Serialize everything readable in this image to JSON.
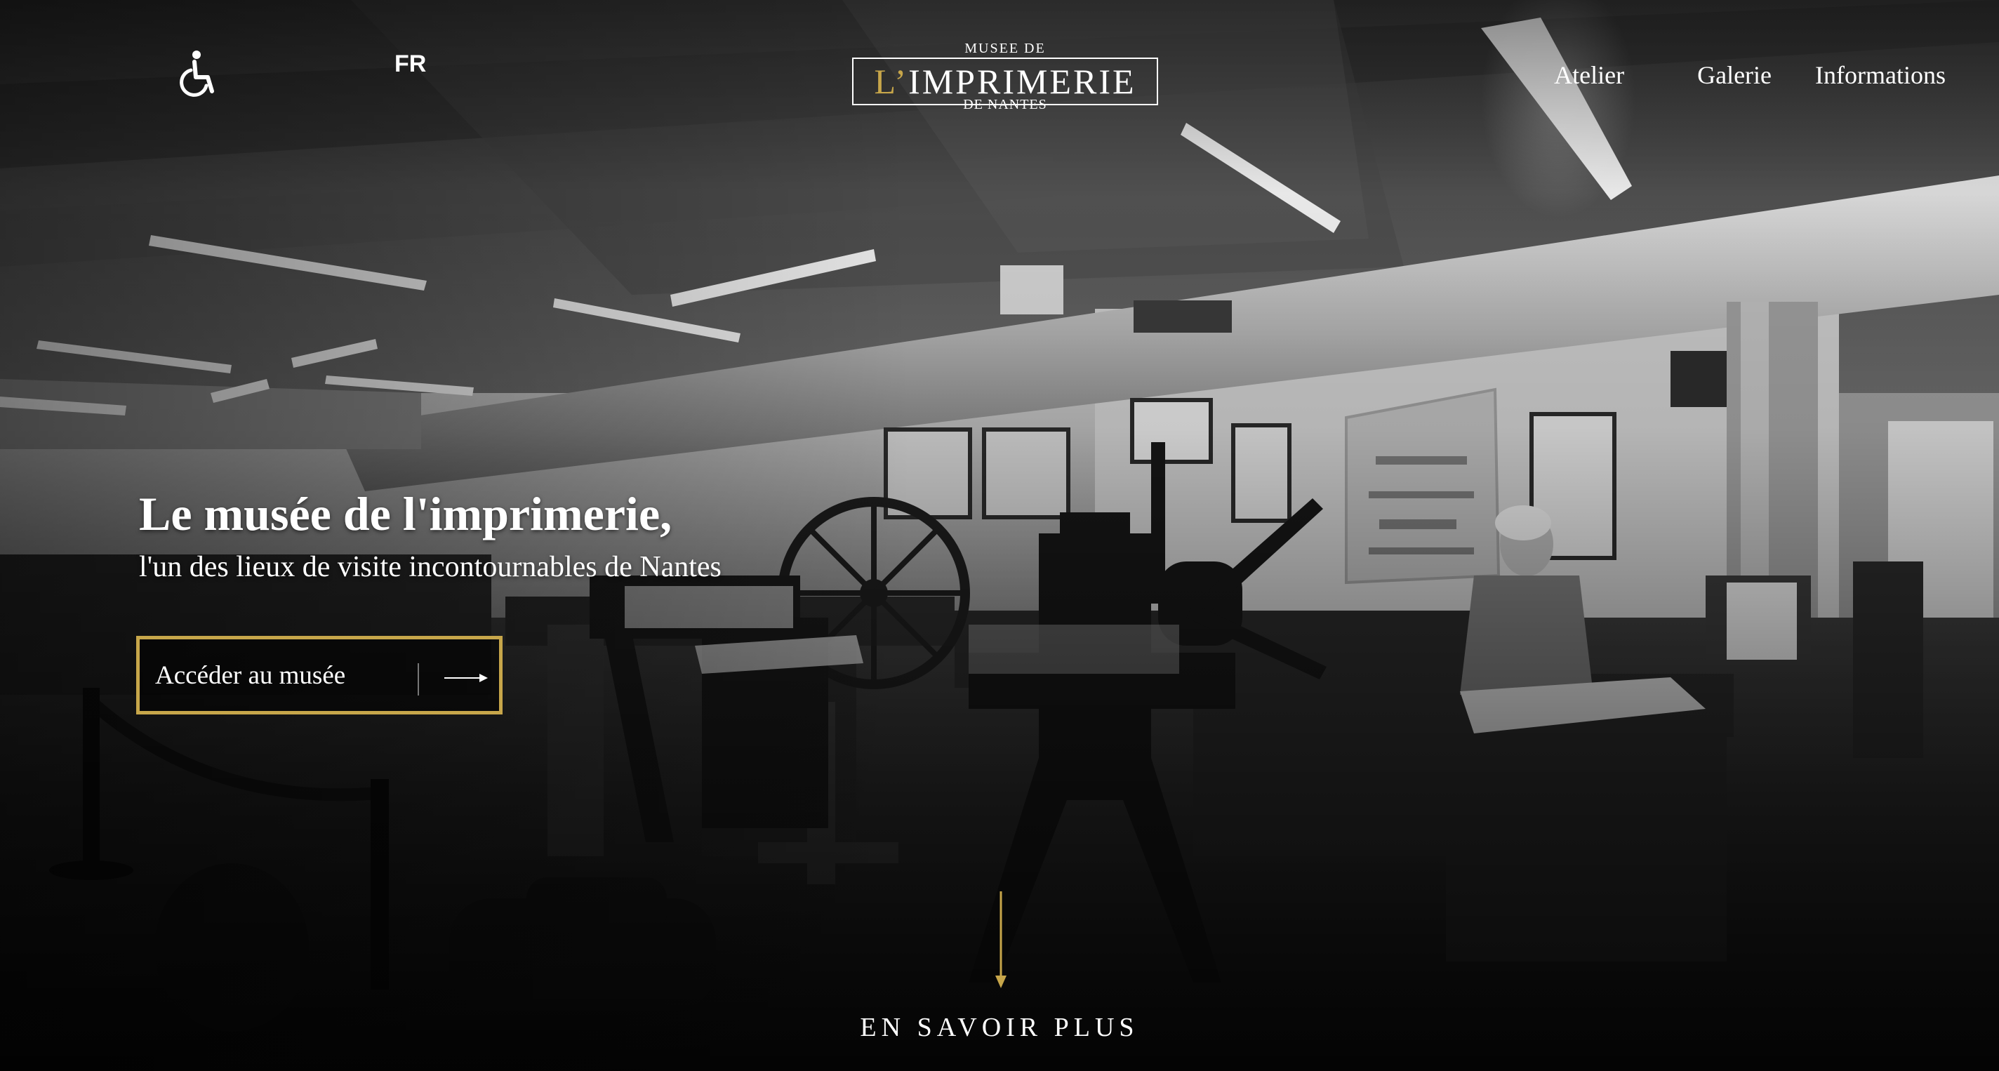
{
  "header": {
    "accessibility_icon": "wheelchair-icon",
    "language": "FR",
    "logo": {
      "line_top": "MUSEE DE",
      "apostrophe_part": "L’",
      "main": "IMPRIMERIE",
      "line_bottom": "DE NANTES"
    },
    "nav": {
      "atelier": "Atelier",
      "galerie": "Galerie",
      "informations": "Informations"
    }
  },
  "hero": {
    "title": "Le musée de l'imprimerie,",
    "subtitle": "l'un des lieux de visite incontournables de Nantes",
    "cta_label": "Accéder au musée",
    "cta_icon": "arrow-right-icon"
  },
  "scroll": {
    "icon": "arrow-down-icon",
    "label": "EN SAVOIR PLUS"
  },
  "colors": {
    "accent_gold": "#c7a64a",
    "text": "#ffffff",
    "background": "#0b0b0b"
  }
}
